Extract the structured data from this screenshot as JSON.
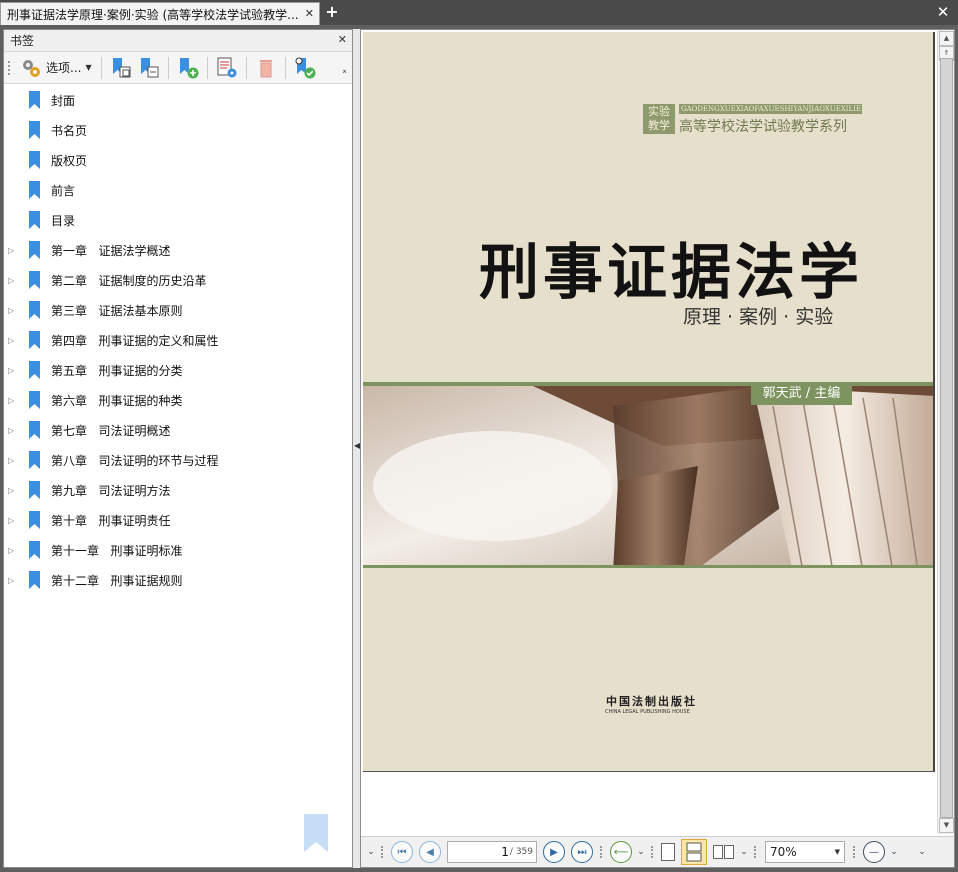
{
  "tab": {
    "title": "刑事证据法学原理·案例·实验 (高等学校法学试验教学..."
  },
  "panel": {
    "title": "书签",
    "options_label": "选项...",
    "bookmarks": [
      {
        "label": "封面",
        "expandable": false
      },
      {
        "label": "书名页",
        "expandable": false
      },
      {
        "label": "版权页",
        "expandable": false
      },
      {
        "label": "前言",
        "expandable": false
      },
      {
        "label": "目录",
        "expandable": false
      },
      {
        "label": "第一章   证据法学概述",
        "expandable": true
      },
      {
        "label": "第二章   证据制度的历史沿革",
        "expandable": true
      },
      {
        "label": "第三章   证据法基本原则",
        "expandable": true
      },
      {
        "label": "第四章   刑事证据的定义和属性",
        "expandable": true
      },
      {
        "label": "第五章   刑事证据的分类",
        "expandable": true
      },
      {
        "label": "第六章   刑事证据的种类",
        "expandable": true
      },
      {
        "label": "第七章   司法证明概述",
        "expandable": true
      },
      {
        "label": "第八章   司法证明的环节与过程",
        "expandable": true
      },
      {
        "label": "第九章   司法证明方法",
        "expandable": true
      },
      {
        "label": "第十章   刑事证明责任",
        "expandable": true
      },
      {
        "label": "第十一章   刑事证明标准",
        "expandable": true
      },
      {
        "label": "第十二章   刑事证据规则",
        "expandable": true
      }
    ]
  },
  "cover": {
    "series_badge": "实验教学",
    "series_pinyin": "GAODENGXUEXIAOFAXUESHIYANJIAOXUEXILIE",
    "series_name": "高等学校法学试验教学系列",
    "title": "刑事证据法学",
    "subtitle": "原理 · 案例 · 实验",
    "author": "郭天武 / 主编",
    "publisher_cn": "中国法制出版社",
    "publisher_en": "CHINA LEGAL PUBLISHING HOUSE"
  },
  "nav": {
    "current_page": "1",
    "total_pages": "/ 359",
    "zoom": "70%"
  },
  "colors": {
    "bookmark_blue": "#3b8fe0",
    "cover_bg": "#e6dfcb",
    "cover_green": "#7d9461"
  }
}
